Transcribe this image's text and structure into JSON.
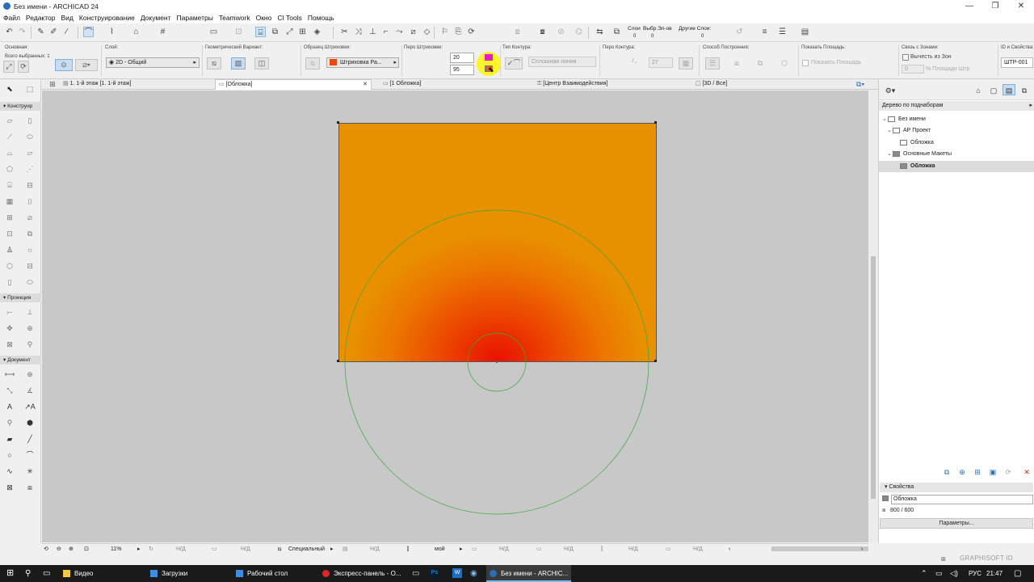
{
  "window": {
    "title": "Без имени - ARCHICAD 24",
    "min": "—",
    "max": "❐",
    "close": "✕"
  },
  "menu": [
    "Файл",
    "Редактор",
    "Вид",
    "Конструирование",
    "Документ",
    "Параметры",
    "Teamwork",
    "Окно",
    "CI Tools",
    "Помощь"
  ],
  "infobox": {
    "main_label": "Основная:",
    "selected_count": "Всего выбранных: 1",
    "layer_label": "Слой:",
    "layer_value": "2D - Общий",
    "geom_label": "Геометрический Вариант:",
    "fill_type_label": "Образец Штриховки:",
    "fill_type_value": "Штриховка Ра...",
    "fill_pen_label": "Перо Штриховки:",
    "fill_pen_value": "20",
    "fill_bg_pen_value": "95",
    "contour_type_label": "Тип Контура:",
    "contour_type_value": "Сплошная линия",
    "contour_pen_label": "Перо Контура:",
    "contour_pen_value": "27",
    "construction_label": "Способ Построения:",
    "show_area_label": "Показать Площадь:",
    "show_area_check": "Показать Площадь",
    "zones_label": "Связь с Зонами:",
    "subtract_label": "Вычесть из Зон",
    "area_pct_value": "0",
    "area_pct_label": "% Площади Штр",
    "id_label": "ID и Свойства:",
    "id_value": "ШТР-001",
    "swatch_fg": "#e61ec3",
    "swatch_bg": "#e46400"
  },
  "toolbar_layers": {
    "layers_label": "Слои",
    "sel_label": "Выбр.Эл-ов",
    "other_label": "Другие Слои:",
    "zero1": "0",
    "zero2": "0",
    "zero3": "0"
  },
  "tabs": [
    {
      "label": "1. 1-й этаж [1. 1-й этаж]"
    },
    {
      "label": "[Обложка]",
      "close": "✕"
    },
    {
      "label": "[1 Обложка]"
    },
    {
      "label": "[Центр Взаимодействия]"
    },
    {
      "label": "[3D / Все]"
    }
  ],
  "toolbox": {
    "groups": [
      "Конструир",
      "Проекция",
      "Документ"
    ]
  },
  "navigator": {
    "mode": "Дерево по поднаборам",
    "tree": [
      {
        "label": "Без имени",
        "level": 0,
        "exp": "⌄"
      },
      {
        "label": "АР Проект",
        "level": 1,
        "exp": "⌄"
      },
      {
        "label": "Обложка",
        "level": 2,
        "exp": ""
      },
      {
        "label": "Основные Макеты",
        "level": 1,
        "exp": "⌄"
      },
      {
        "label": "Обложка",
        "level": 2,
        "exp": ""
      }
    ],
    "properties_header": "Свойства",
    "properties_name": "Обложка",
    "properties_size": "800 / 600",
    "parameters_button": "Параметры..."
  },
  "statusbar": {
    "zoom": "11%",
    "nd": "Н/Д",
    "special": "Специальный",
    "mine": "мой"
  },
  "brand": "GRAPHISOFT ID",
  "taskbar": {
    "items": [
      "Видео",
      "Загрузки",
      "Рабочий стол",
      "Экспресс-панель - О...",
      "Без имени - ARCHIC..."
    ],
    "lang": "РУС",
    "time": "21:47"
  }
}
